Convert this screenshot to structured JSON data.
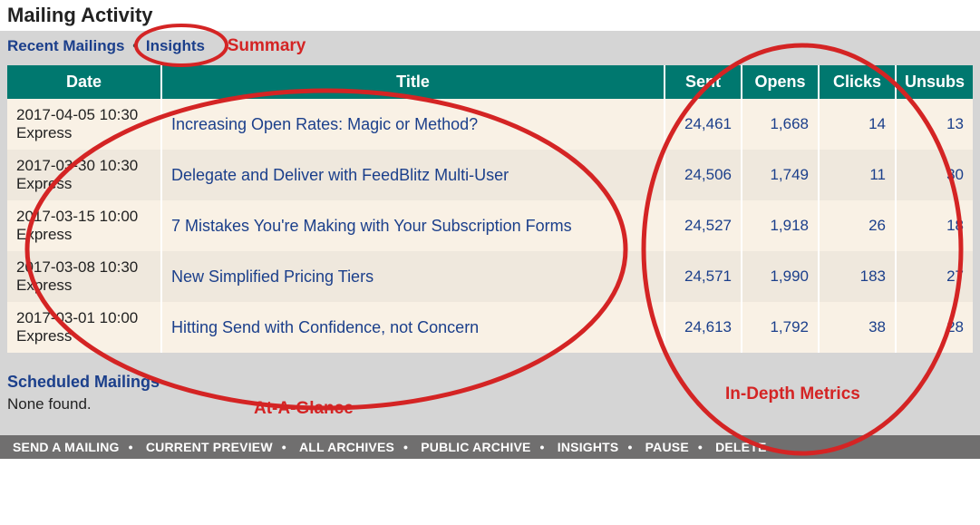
{
  "page_title": "Mailing Activity",
  "tabs": {
    "recent": "Recent Mailings",
    "insights": "Insights"
  },
  "annotations": {
    "summary": "Summary",
    "at_a_glance": "At-A-Glance",
    "in_depth": "In-Depth Metrics"
  },
  "columns": {
    "date": "Date",
    "title": "Title",
    "sent": "Sent",
    "opens": "Opens",
    "clicks": "Clicks",
    "unsubs": "Unsubs"
  },
  "rows": [
    {
      "date": "2017-04-05 10:30",
      "method": "Express",
      "title": "Increasing Open Rates: Magic or Method?",
      "sent": "24,461",
      "opens": "1,668",
      "clicks": "14",
      "unsubs": "13"
    },
    {
      "date": "2017-03-30 10:30",
      "method": "Express",
      "title": "Delegate and Deliver with FeedBlitz Multi-User",
      "sent": "24,506",
      "opens": "1,749",
      "clicks": "11",
      "unsubs": "30"
    },
    {
      "date": "2017-03-15 10:00",
      "method": "Express",
      "title": "7 Mistakes You're Making with Your Subscription Forms",
      "sent": "24,527",
      "opens": "1,918",
      "clicks": "26",
      "unsubs": "18"
    },
    {
      "date": "2017-03-08 10:30",
      "method": "Express",
      "title": "New Simplified Pricing Tiers",
      "sent": "24,571",
      "opens": "1,990",
      "clicks": "183",
      "unsubs": "27"
    },
    {
      "date": "2017-03-01 10:00",
      "method": "Express",
      "title": "Hitting Send with Confidence, not Concern",
      "sent": "24,613",
      "opens": "1,792",
      "clicks": "38",
      "unsubs": "28"
    }
  ],
  "scheduled": {
    "heading": "Scheduled Mailings",
    "none": "None found."
  },
  "footer": {
    "send": "SEND A MAILING",
    "preview": "CURRENT PREVIEW",
    "archives": "ALL ARCHIVES",
    "public": "PUBLIC ARCHIVE",
    "insights": "INSIGHTS",
    "pause": "PAUSE",
    "delete": "DELETE"
  }
}
